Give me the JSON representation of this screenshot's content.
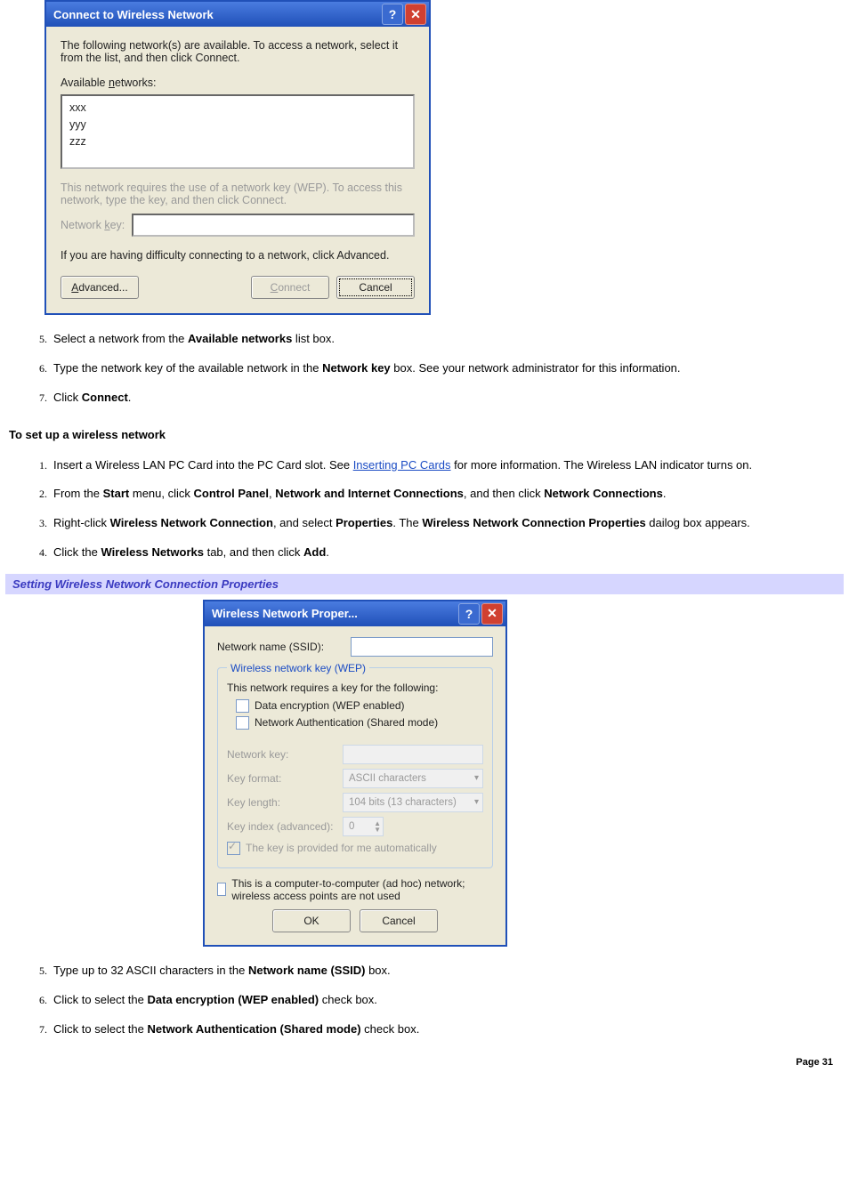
{
  "dlg1": {
    "title": "Connect to Wireless Network",
    "help": "?",
    "close": "✕",
    "intro": "The following network(s) are available. To access a network, select it from the list, and then click Connect.",
    "available_label_pre": "Available ",
    "available_label_u": "n",
    "available_label_post": "etworks:",
    "networks": [
      "xxx",
      "yyy",
      "zzz"
    ],
    "wep_note": "This network requires the use of a network key (WEP). To access this network, type the key, and then click Connect.",
    "netkey_label_pre": "Network ",
    "netkey_label_u": "k",
    "netkey_label_post": "ey:",
    "difficulty": "If you are having difficulty connecting to a network, click Advanced.",
    "btn_advanced_u": "A",
    "btn_advanced_rest": "dvanced...",
    "btn_connect_u": "C",
    "btn_connect_rest": "onnect",
    "btn_cancel": "Cancel"
  },
  "steps_a": {
    "s5_pre": "Select a network from the ",
    "s5_b": "Available networks",
    "s5_post": " list box.",
    "s6_pre": "Type the network key of the available network in the ",
    "s6_b": "Network key",
    "s6_post": " box. See your network administrator for this information.",
    "s7_pre": "Click ",
    "s7_b": "Connect",
    "s7_post": "."
  },
  "section_heading": "To set up a wireless network",
  "steps_b": {
    "s1_pre": "Insert a Wireless LAN PC Card into the PC Card slot. See ",
    "s1_link": "Inserting PC Cards",
    "s1_post": " for more information. The Wireless LAN indicator turns on.",
    "s2_pre": "From the ",
    "s2_b1": "Start",
    "s2_mid1": " menu, click ",
    "s2_b2": "Control Panel",
    "s2_mid2": ", ",
    "s2_b3": "Network and Internet Connections",
    "s2_mid3": ", and then click ",
    "s2_b4": "Network Connections",
    "s2_post": ".",
    "s3_pre": "Right-click ",
    "s3_b1": "Wireless Network Connection",
    "s3_mid1": ", and select ",
    "s3_b2": "Properties",
    "s3_mid2": ". The ",
    "s3_b3": "Wireless Network Connection Properties",
    "s3_post": " dailog box appears.",
    "s4_pre": "Click the ",
    "s4_b1": "Wireless Networks",
    "s4_mid1": " tab, and then click ",
    "s4_b2": "Add",
    "s4_post": "."
  },
  "caption": "Setting Wireless Network Connection Properties",
  "dlg2": {
    "title": "Wireless Network Proper...",
    "help": "?",
    "close": "✕",
    "ssid_label": "Network name (SSID):",
    "group_legend": "Wireless network key (WEP)",
    "requires": "This network requires a key for the following:",
    "chk1": "Data encryption (WEP enabled)",
    "chk2": "Network Authentication (Shared mode)",
    "netkey_label": "Network key:",
    "keyformat_label": "Key format:",
    "keyformat_value": "ASCII characters",
    "keylength_label": "Key length:",
    "keylength_value": "104 bits (13 characters)",
    "keyindex_label": "Key index (advanced):",
    "keyindex_value": "0",
    "autokey": "The key is provided for me automatically",
    "adhoc": "This is a computer-to-computer (ad hoc) network; wireless access points are not used",
    "btn_ok": "OK",
    "btn_cancel": "Cancel"
  },
  "steps_c": {
    "s5_pre": "Type up to 32 ASCII characters in the ",
    "s5_b": "Network name (SSID)",
    "s5_post": " box.",
    "s6_pre": "Click to select the ",
    "s6_b": "Data encryption (WEP enabled)",
    "s6_post": " check box.",
    "s7_pre": "Click to select the ",
    "s7_b": "Network Authentication (Shared mode)",
    "s7_post": " check box."
  },
  "page_number": "Page 31"
}
